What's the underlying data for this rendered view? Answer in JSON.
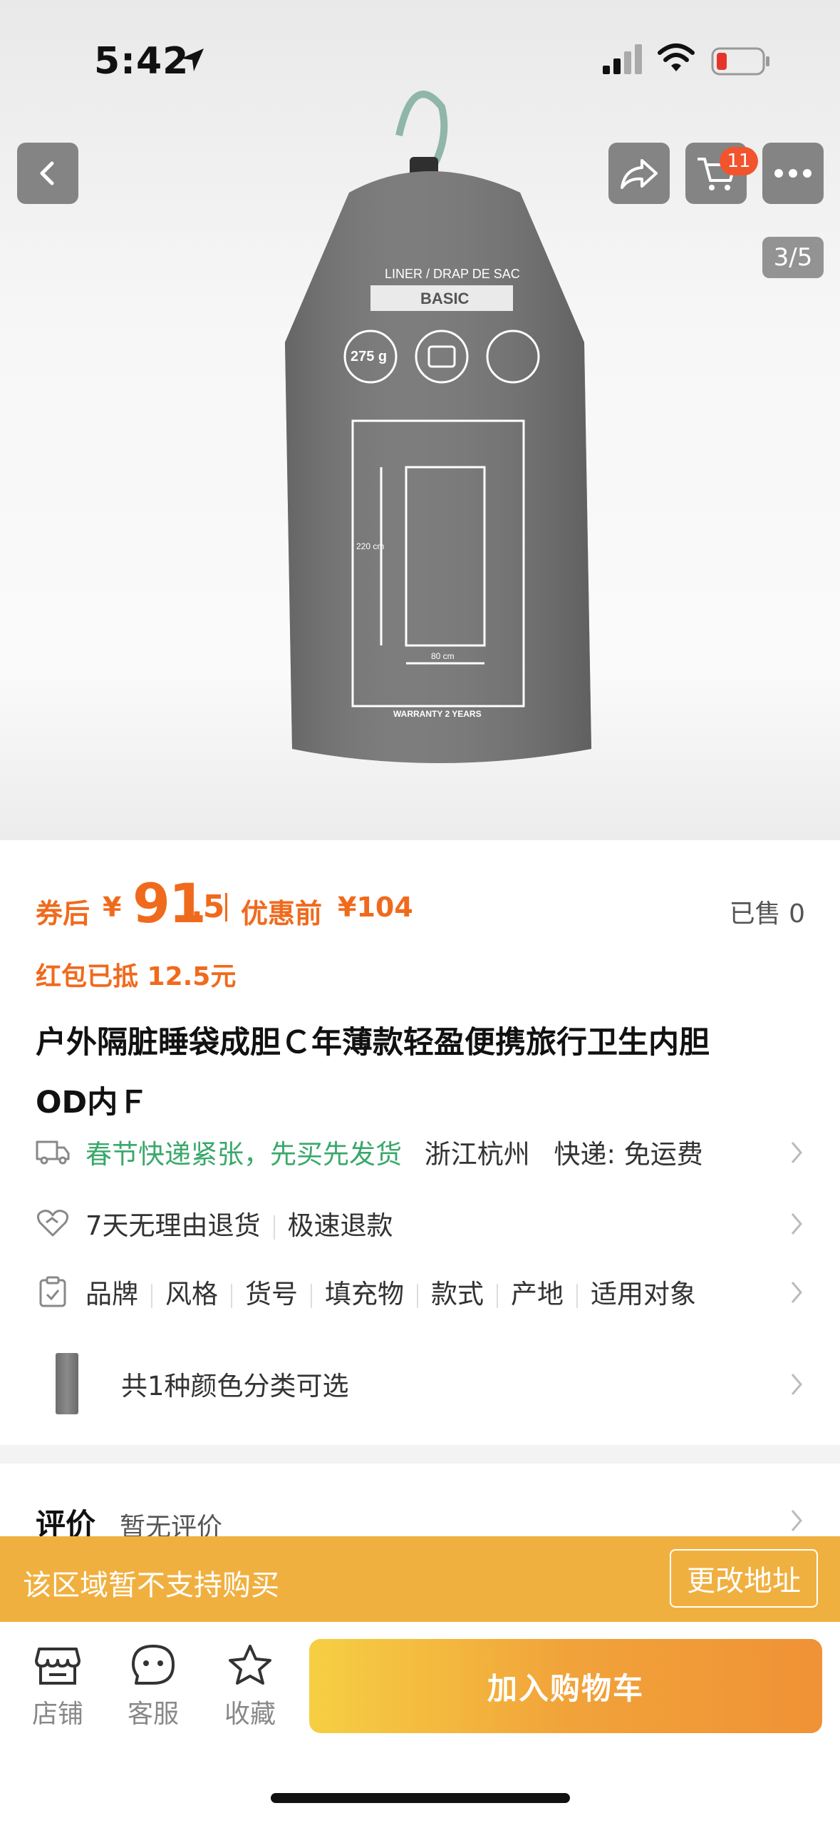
{
  "status_bar": {
    "time": "5:42"
  },
  "header": {
    "cart_count": "11",
    "image_index": "3/5"
  },
  "product_image": {
    "liner_text": "LINER / DRAP DE SAC",
    "model_text": "BASIC",
    "weight_text": "275 g",
    "length_text": "220 cm",
    "width_text": "80 cm",
    "warranty_text": "WARRANTY 2 YEARS"
  },
  "price": {
    "after_label": "券后",
    "currency": "¥",
    "price_int": "91",
    "price_dec": ".5",
    "before_label": "优惠前",
    "before_value": "¥104",
    "sold": "已售 0"
  },
  "redpack": "红包已抵 12.5元",
  "title": "户外隔脏睡袋成胆Ｃ年薄款轻盈便携旅行卫生内胆ODＦ内Ｆ",
  "title_line1": "户外隔脏睡袋成胆Ｃ年薄款轻盈便携旅行卫生内胆",
  "title_line2": "OD内Ｆ",
  "delivery": {
    "highlight": "春节快递紧张，先买先发货",
    "location": "浙江杭州",
    "shipping": "快递: 免运费"
  },
  "service": {
    "return": "7天无理由退货",
    "refund": "极速退款"
  },
  "params": [
    "品牌",
    "风格",
    "货号",
    "填充物",
    "款式",
    "产地",
    "适用对象"
  ],
  "variants": "共1种颜色分类可选",
  "review": {
    "title": "评价",
    "subtitle": "暂无评价"
  },
  "notice": {
    "text": "该区域暂不支持购买",
    "button": "更改地址"
  },
  "bottom_bar": {
    "store": "店铺",
    "service": "客服",
    "favorite": "收藏",
    "add_to_cart": "加入购物车"
  },
  "colors": {
    "accent_orange": "#f06a1d",
    "green": "#3aa86b",
    "notice_bg": "#f0b040"
  }
}
